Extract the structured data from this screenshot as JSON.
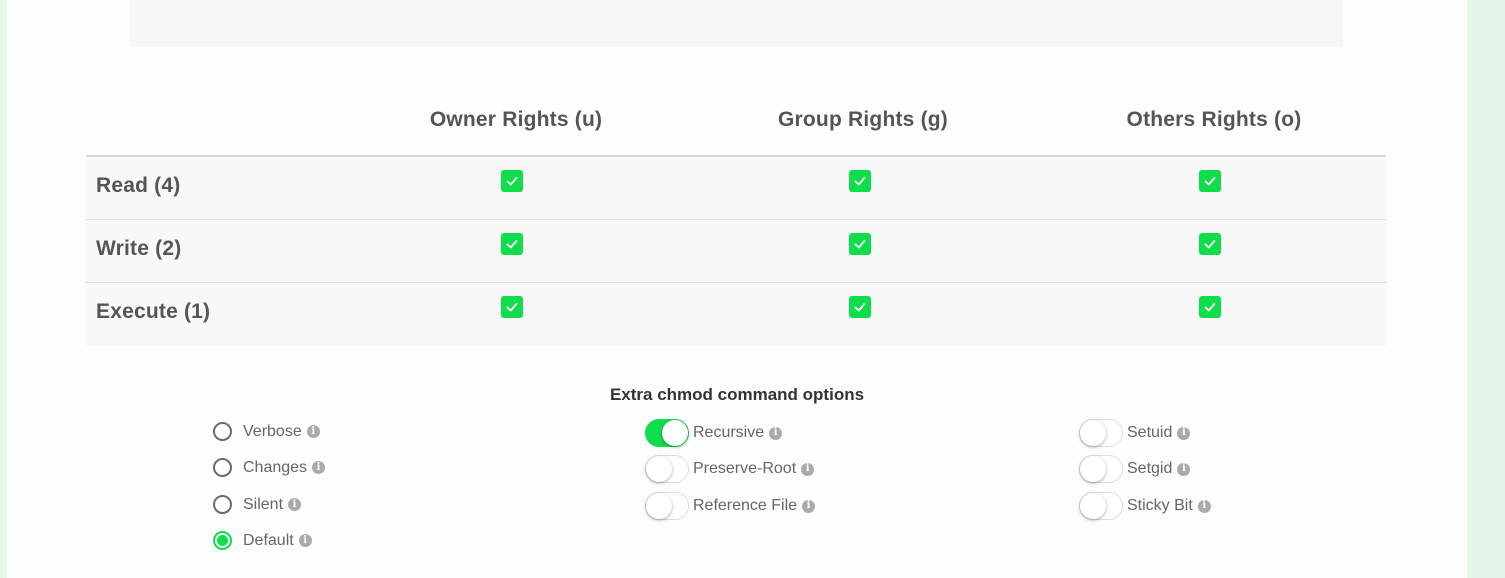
{
  "table": {
    "headers": [
      "Owner Rights (u)",
      "Group Rights (g)",
      "Others Rights (o)"
    ],
    "rows": [
      {
        "label": "Read (4)",
        "checked": [
          true,
          true,
          true
        ]
      },
      {
        "label": "Write (2)",
        "checked": [
          true,
          true,
          true
        ]
      },
      {
        "label": "Execute (1)",
        "checked": [
          true,
          true,
          true
        ]
      }
    ]
  },
  "options": {
    "title": "Extra chmod command options",
    "verbosity": [
      {
        "label": "Verbose",
        "selected": false
      },
      {
        "label": "Changes",
        "selected": false
      },
      {
        "label": "Silent",
        "selected": false
      },
      {
        "label": "Default",
        "selected": true
      }
    ],
    "middle_toggles": [
      {
        "label": "Recursive",
        "on": true
      },
      {
        "label": "Preserve-Root",
        "on": false
      },
      {
        "label": "Reference File",
        "on": false
      }
    ],
    "special_bits": [
      {
        "label": "Setuid",
        "on": false
      },
      {
        "label": "Setgid",
        "on": false
      },
      {
        "label": "Sticky Bit",
        "on": false
      }
    ],
    "info_icon_glyph": "i"
  },
  "colors": {
    "accent": "#10dd4b",
    "text": "#555555",
    "page_background": "#e5f6ea"
  }
}
